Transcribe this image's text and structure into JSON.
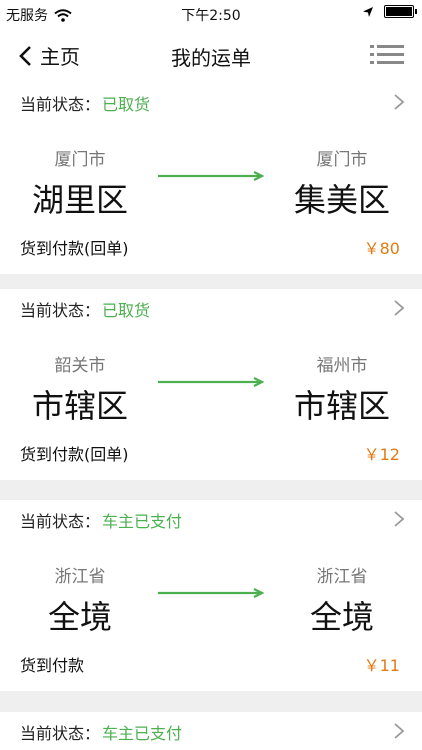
{
  "status_bar": {
    "carrier": "无服务",
    "time": "下午2:50"
  },
  "nav": {
    "back_label": "主页",
    "title": "我的运单"
  },
  "status_label": "当前状态：",
  "orders": [
    {
      "status": "已取货",
      "from_city": "厦门市",
      "from_district": "湖里区",
      "to_city": "厦门市",
      "to_district": "集美区",
      "payment": "货到付款(回单)",
      "price": "￥80"
    },
    {
      "status": "已取货",
      "from_city": "韶关市",
      "from_district": "市辖区",
      "to_city": "福州市",
      "to_district": "市辖区",
      "payment": "货到付款(回单)",
      "price": "￥12"
    },
    {
      "status": "车主已支付",
      "from_city": "浙江省",
      "from_district": "全境",
      "to_city": "浙江省",
      "to_district": "全境",
      "payment": "货到付款",
      "price": "￥11"
    },
    {
      "status": "车主已支付"
    }
  ],
  "colors": {
    "accent_green": "#4caf50",
    "price_orange": "#e07b16"
  }
}
